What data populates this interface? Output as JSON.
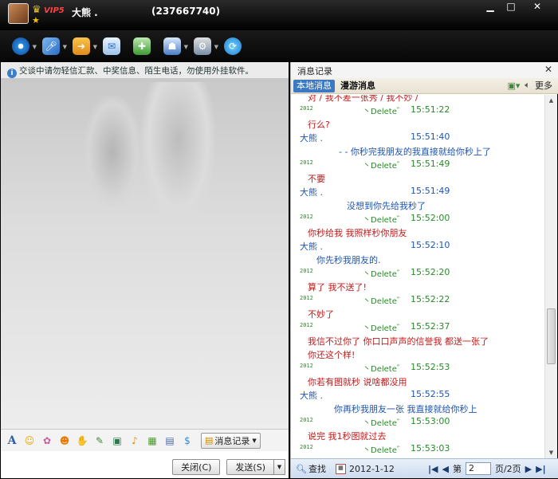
{
  "titlebar": {
    "vip_label": "VIP5",
    "nickname": "大熊 .",
    "qq_number": "(237667740)",
    "minimize": "▁",
    "maximize": "□",
    "close": "✕"
  },
  "toolbar": {
    "icons": [
      "video-call-icon",
      "voice-call-icon",
      "file-transfer-icon",
      "email-icon",
      "app-icon",
      "remote-assist-icon",
      "settings-icon",
      "share-icon"
    ]
  },
  "left": {
    "notice": "交谈中请勿轻信汇款、中奖信息、陌生电话，勿使用外挂软件。",
    "format_icons": [
      "font-icon",
      "emoji-icon",
      "magic-emoticon-icon",
      "nudge-icon",
      "gift-icon",
      "screenshot-icon",
      "image-icon",
      "music-icon",
      "doodle-icon",
      "more-icon",
      "quick-reply-icon"
    ],
    "record_btn": "消息记录",
    "close_btn": "关闭(C)",
    "send_btn": "发送(S)"
  },
  "right": {
    "title": "消息记录",
    "close": "✕",
    "tab_local": "本地消息",
    "tab_roam": "漫游消息",
    "more": "更多",
    "messages": [
      {
        "type": "red",
        "text": "对 / 我不差一张秀 / 我不妙 /"
      },
      {
        "type": "stamp",
        "year": "2012",
        "del": "丶Delete゛",
        "time": "15:51:22"
      },
      {
        "type": "red",
        "text": "行么?"
      },
      {
        "type": "sender",
        "name": "大熊 .",
        "time": "15:51:40"
      },
      {
        "type": "blue",
        "indent": 60,
        "text": "- -  你秒完我朋友的我直接就给你秒上了"
      },
      {
        "type": "stamp",
        "year": "2012",
        "del": "丶Delete゛",
        "time": "15:51:49"
      },
      {
        "type": "red",
        "text": "不要"
      },
      {
        "type": "sender",
        "name": "大熊 .",
        "time": "15:51:49"
      },
      {
        "type": "blue",
        "indent": 70,
        "text": "没想到你先给我秒了"
      },
      {
        "type": "stamp",
        "year": "2012",
        "del": "丶Delete゛",
        "time": "15:52:00"
      },
      {
        "type": "red",
        "text": "你秒给我 我照样秒你朋友"
      },
      {
        "type": "sender",
        "name": "大熊 .",
        "time": "15:52:10"
      },
      {
        "type": "blue",
        "indent": 32,
        "text": "你先秒我朋友的."
      },
      {
        "type": "stamp",
        "year": "2012",
        "del": "丶Delete゛",
        "time": "15:52:20"
      },
      {
        "type": "red",
        "text": "算了 我不送了!"
      },
      {
        "type": "stamp",
        "year": "2012",
        "del": "丶Delete゛",
        "time": "15:52:22"
      },
      {
        "type": "red",
        "text": "不妙了"
      },
      {
        "type": "stamp",
        "year": "2012",
        "del": "丶Delete゛",
        "time": "15:52:37"
      },
      {
        "type": "red",
        "text": "我信不过你了 你口口声声的信誉我 都送一张了"
      },
      {
        "type": "red",
        "text": "你还这个样!"
      },
      {
        "type": "stamp",
        "year": "2012",
        "del": "丶Delete゛",
        "time": "15:52:53"
      },
      {
        "type": "red",
        "text": "你若有图就秒 说啥都没用"
      },
      {
        "type": "sender",
        "name": "大熊 .",
        "time": "15:52:55"
      },
      {
        "type": "blue",
        "indent": 54,
        "text": "你再秒我朋友一张    我直接就给你秒上"
      },
      {
        "type": "stamp",
        "year": "2012",
        "del": "丶Delete゛",
        "time": "15:53:00"
      },
      {
        "type": "red",
        "text": "说完 我1秒图就过去"
      },
      {
        "type": "stamp",
        "year": "2012",
        "del": "丶Delete゛",
        "time": "15:53:03"
      }
    ],
    "footer": {
      "find": "查找",
      "date": "2012-1-12",
      "first": "|◀",
      "prev": "◀",
      "page_label": "第",
      "page_value": "2",
      "page_total": "页/2页",
      "next": "▶",
      "last": "▶|"
    }
  },
  "colors": {
    "accent": "#3d79c2",
    "peer_text": "#c41a1a",
    "self_text": "#1f55b0",
    "stamp_green": "#2a8a2a"
  }
}
